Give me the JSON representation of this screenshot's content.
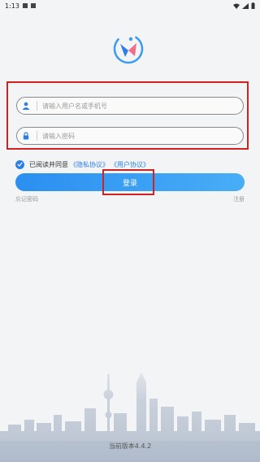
{
  "status_bar": {
    "time": "1:13"
  },
  "login_form": {
    "username_placeholder": "请输入用户名或手机号",
    "password_placeholder": "请输入密码",
    "agreement_text": "已阅读并同意",
    "privacy_link": "《隐私协议》",
    "user_agreement_link": "《用户协议》",
    "login_button": "登录",
    "forgot_password": "忘记密码",
    "register": "注册"
  },
  "footer": {
    "version_text": "当前版本4.4.2"
  },
  "colors": {
    "accent": "#2d7fe6",
    "highlight": "#d32020"
  },
  "icons": [
    "signal-icon",
    "wifi-icon",
    "battery-icon",
    "user-icon",
    "lock-icon",
    "check-icon",
    "app-logo-icon"
  ]
}
